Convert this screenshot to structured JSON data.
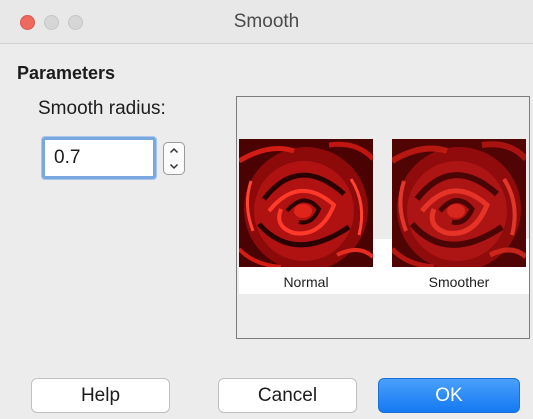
{
  "window": {
    "title": "Smooth"
  },
  "parameters": {
    "section_title": "Parameters",
    "radius_label": "Smooth radius:",
    "radius_value": "0.7"
  },
  "preview": {
    "normal_caption": "Normal",
    "smoother_caption": "Smoother"
  },
  "buttons": {
    "help": "Help",
    "cancel": "Cancel",
    "ok": "OK"
  },
  "icons": {
    "close": "close-icon",
    "minimize": "minimize-icon",
    "maximize": "maximize-icon",
    "stepper_up": "chevron-up-icon",
    "stepper_down": "chevron-down-icon"
  },
  "colors": {
    "accent": "#1479f2",
    "close": "#ee6a5e",
    "focus_ring": "#7aa7e0"
  }
}
